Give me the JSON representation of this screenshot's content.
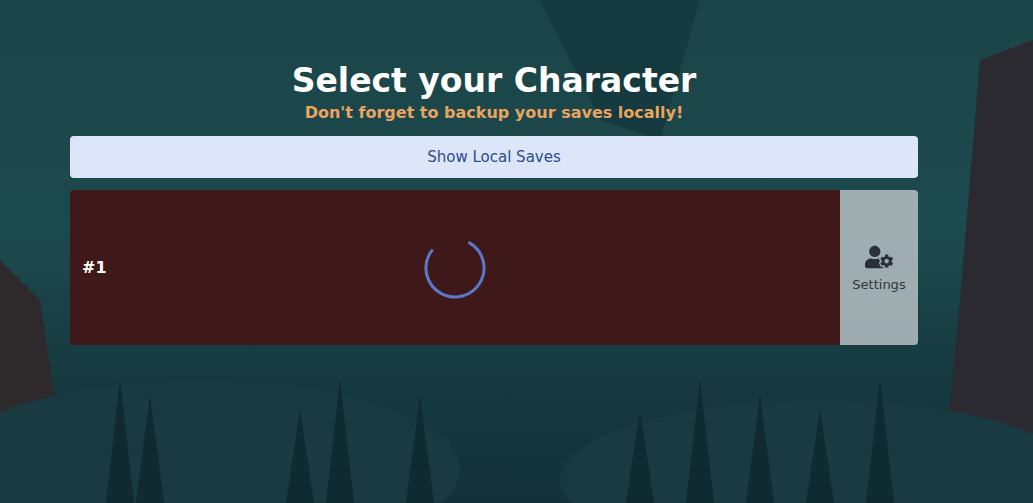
{
  "screen": {
    "title": "Select your Character",
    "subtitle": "Don't forget to backup your saves locally!"
  },
  "show_saves_button": {
    "label": "Show Local Saves"
  },
  "characters": [
    {
      "number": "#1",
      "loading": true,
      "settings_label": "Settings"
    }
  ]
}
